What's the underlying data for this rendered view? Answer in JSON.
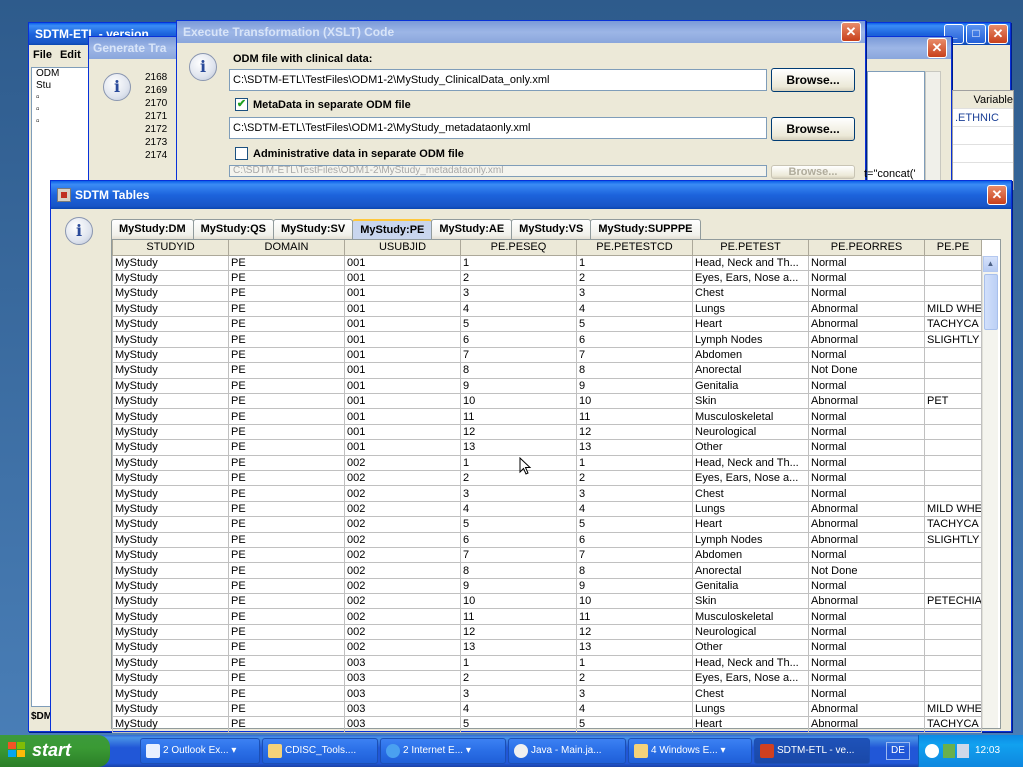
{
  "app": {
    "title": "SDTM-ETL - version ...",
    "menu": [
      "File",
      "Edit"
    ],
    "tree": [
      "ODM",
      "Stu",
      "",
      "",
      "",
      ""
    ],
    "bottom_label": "$DM"
  },
  "generate": {
    "title": "Generate Tra",
    "numbers": [
      "2168",
      "2169",
      "2170",
      "2171",
      "2172",
      "2173",
      "2174"
    ]
  },
  "right_panel": {
    "header": "Variable",
    "rows": [
      ".ETHNIC",
      "",
      "",
      "",
      ""
    ],
    "code_fragment": "t=\"concat('"
  },
  "xslt": {
    "title": "Execute Transformation (XSLT) Code",
    "odm_label": "ODM file with clinical data:",
    "odm_path": "C:\\SDTM-ETL\\TestFiles\\ODM1-2\\MyStudy_ClinicalData_only.xml",
    "meta_checked": true,
    "meta_label": "MetaData in separate ODM file",
    "meta_path": "C:\\SDTM-ETL\\TestFiles\\ODM1-2\\MyStudy_metadataonly.xml",
    "admin_checked": false,
    "admin_label": "Administrative data in separate ODM file",
    "admin_path": "C:\\SDTM-ETL\\TestFiles\\ODM1-2\\MyStudy_metadataonly.xml",
    "browse_label": "Browse..."
  },
  "sdtm": {
    "title": "SDTM Tables",
    "tabs": [
      "MyStudy:DM",
      "MyStudy:QS",
      "MyStudy:SV",
      "MyStudy:PE",
      "MyStudy:AE",
      "MyStudy:VS",
      "MyStudy:SUPPPE"
    ],
    "selected_tab": "MyStudy:PE",
    "columns": [
      "STUDYID",
      "DOMAIN",
      "USUBJID",
      "PE.PESEQ",
      "PE.PETESTCD",
      "PE.PETEST",
      "PE.PEORRES",
      "PE.PE"
    ],
    "rows": [
      [
        "MyStudy",
        "PE",
        "001",
        "1",
        "1",
        "Head, Neck and Th...",
        "Normal",
        ""
      ],
      [
        "MyStudy",
        "PE",
        "001",
        "2",
        "2",
        "Eyes, Ears, Nose a...",
        "Normal",
        ""
      ],
      [
        "MyStudy",
        "PE",
        "001",
        "3",
        "3",
        "Chest",
        "Normal",
        ""
      ],
      [
        "MyStudy",
        "PE",
        "001",
        "4",
        "4",
        "Lungs",
        "Abnormal",
        "MILD WHE"
      ],
      [
        "MyStudy",
        "PE",
        "001",
        "5",
        "5",
        "Heart",
        "Abnormal",
        "TACHYCA"
      ],
      [
        "MyStudy",
        "PE",
        "001",
        "6",
        "6",
        "Lymph Nodes",
        "Abnormal",
        "SLIGHTLY"
      ],
      [
        "MyStudy",
        "PE",
        "001",
        "7",
        "7",
        "Abdomen",
        "Normal",
        ""
      ],
      [
        "MyStudy",
        "PE",
        "001",
        "8",
        "8",
        "Anorectal",
        "Not Done",
        ""
      ],
      [
        "MyStudy",
        "PE",
        "001",
        "9",
        "9",
        "Genitalia",
        "Normal",
        ""
      ],
      [
        "MyStudy",
        "PE",
        "001",
        "10",
        "10",
        "Skin",
        "Abnormal",
        "PET"
      ],
      [
        "MyStudy",
        "PE",
        "001",
        "11",
        "11",
        "Musculoskeletal",
        "Normal",
        ""
      ],
      [
        "MyStudy",
        "PE",
        "001",
        "12",
        "12",
        "Neurological",
        "Normal",
        ""
      ],
      [
        "MyStudy",
        "PE",
        "001",
        "13",
        "13",
        "Other",
        "Normal",
        ""
      ],
      [
        "MyStudy",
        "PE",
        "002",
        "1",
        "1",
        "Head, Neck and Th...",
        "Normal",
        ""
      ],
      [
        "MyStudy",
        "PE",
        "002",
        "2",
        "2",
        "Eyes, Ears, Nose a...",
        "Normal",
        ""
      ],
      [
        "MyStudy",
        "PE",
        "002",
        "3",
        "3",
        "Chest",
        "Normal",
        ""
      ],
      [
        "MyStudy",
        "PE",
        "002",
        "4",
        "4",
        "Lungs",
        "Abnormal",
        "MILD WHE"
      ],
      [
        "MyStudy",
        "PE",
        "002",
        "5",
        "5",
        "Heart",
        "Abnormal",
        "TACHYCA"
      ],
      [
        "MyStudy",
        "PE",
        "002",
        "6",
        "6",
        "Lymph Nodes",
        "Abnormal",
        "SLIGHTLY"
      ],
      [
        "MyStudy",
        "PE",
        "002",
        "7",
        "7",
        "Abdomen",
        "Normal",
        ""
      ],
      [
        "MyStudy",
        "PE",
        "002",
        "8",
        "8",
        "Anorectal",
        "Not Done",
        ""
      ],
      [
        "MyStudy",
        "PE",
        "002",
        "9",
        "9",
        "Genitalia",
        "Normal",
        ""
      ],
      [
        "MyStudy",
        "PE",
        "002",
        "10",
        "10",
        "Skin",
        "Abnormal",
        "PETECHIA"
      ],
      [
        "MyStudy",
        "PE",
        "002",
        "11",
        "11",
        "Musculoskeletal",
        "Normal",
        ""
      ],
      [
        "MyStudy",
        "PE",
        "002",
        "12",
        "12",
        "Neurological",
        "Normal",
        ""
      ],
      [
        "MyStudy",
        "PE",
        "002",
        "13",
        "13",
        "Other",
        "Normal",
        ""
      ],
      [
        "MyStudy",
        "PE",
        "003",
        "1",
        "1",
        "Head, Neck and Th...",
        "Normal",
        ""
      ],
      [
        "MyStudy",
        "PE",
        "003",
        "2",
        "2",
        "Eyes, Ears, Nose a...",
        "Normal",
        ""
      ],
      [
        "MyStudy",
        "PE",
        "003",
        "3",
        "3",
        "Chest",
        "Normal",
        ""
      ],
      [
        "MyStudy",
        "PE",
        "003",
        "4",
        "4",
        "Lungs",
        "Abnormal",
        "MILD WHE"
      ],
      [
        "MyStudy",
        "PE",
        "003",
        "5",
        "5",
        "Heart",
        "Abnormal",
        "TACHYCA"
      ]
    ]
  },
  "taskbar": {
    "start_label": "start",
    "buttons": [
      "2 Outlook Ex...",
      "CDISC_Tools....",
      "2 Internet E...",
      "Java - Main.ja...",
      "4 Windows E...",
      "SDTM-ETL - ve..."
    ],
    "language": "DE",
    "clock": "12:03"
  },
  "colors": {
    "titlebar_blue": "#1c63dc",
    "selected_tab": "#c9d6ee",
    "close_red": "#c8401c",
    "start_green": "#3a9a34"
  }
}
